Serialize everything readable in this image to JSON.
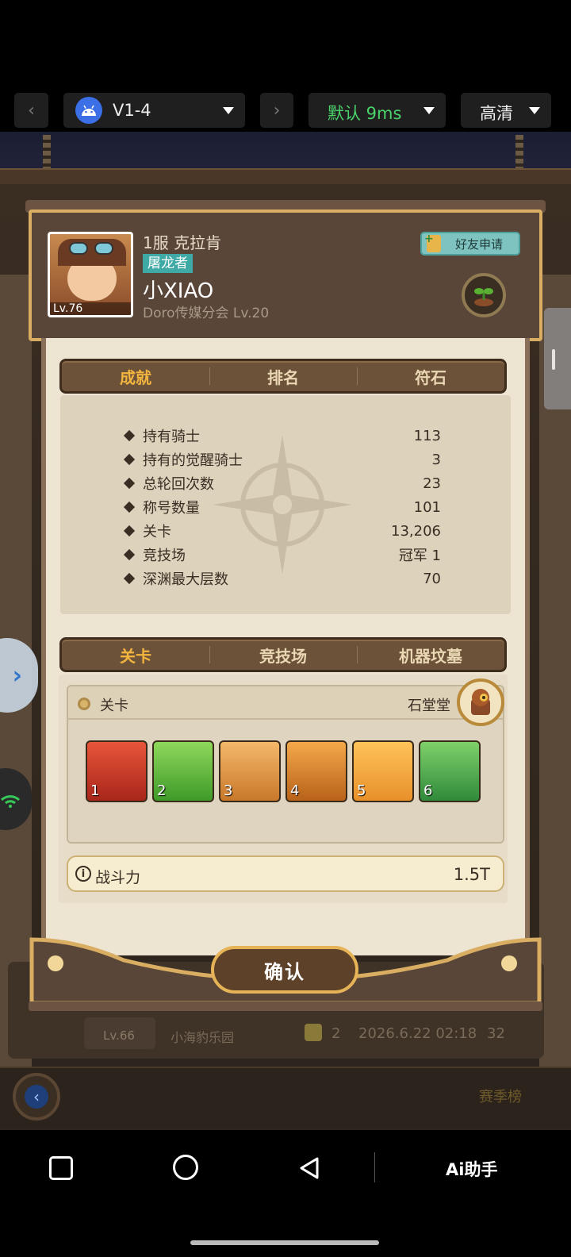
{
  "topbar": {
    "version_label": "V1-4",
    "network_label": "默认 9ms",
    "quality_label": "高清"
  },
  "profile": {
    "server": "1服 克拉肯",
    "title_badge": "屠龙者",
    "name": "小XIAO",
    "guild": "Doro传媒分会 Lv.20",
    "avatar_level": "Lv.76",
    "friend_request_label": "好友申请"
  },
  "tabs_top": [
    "成就",
    "排名",
    "符石"
  ],
  "stats": [
    {
      "label": "持有骑士",
      "value": "113"
    },
    {
      "label": "持有的觉醒骑士",
      "value": "3"
    },
    {
      "label": "总轮回次数",
      "value": "23"
    },
    {
      "label": "称号数量",
      "value": "101"
    },
    {
      "label": "关卡",
      "value": "13,206"
    },
    {
      "label": "竞技场",
      "value": "冠军 1"
    },
    {
      "label": "深渊最大层数",
      "value": "70"
    }
  ],
  "tabs_bottom": [
    "关卡",
    "竞技场",
    "机器坟墓"
  ],
  "team": {
    "header_label": "关卡",
    "pet_name": "石堂堂",
    "slots": [
      "1",
      "2",
      "3",
      "4",
      "5",
      "6"
    ]
  },
  "power": {
    "label": "战斗力",
    "value": "1.5T"
  },
  "confirm_label": "确认",
  "background": {
    "level_label": "Lv.66",
    "park_label": "小海豹乐园",
    "count": "2",
    "datetime": "2026.6.22 02:18",
    "score": "32",
    "season_label": "赛季榜"
  },
  "navbar": {
    "assistant_label": "Ai助手"
  },
  "colors": {
    "accent_gold": "#f3b53f",
    "tab_bar": "#6b5239",
    "parchment": "#ede4d2",
    "network_green": "#4bd36b",
    "badge_teal": "#3fa9a5"
  }
}
